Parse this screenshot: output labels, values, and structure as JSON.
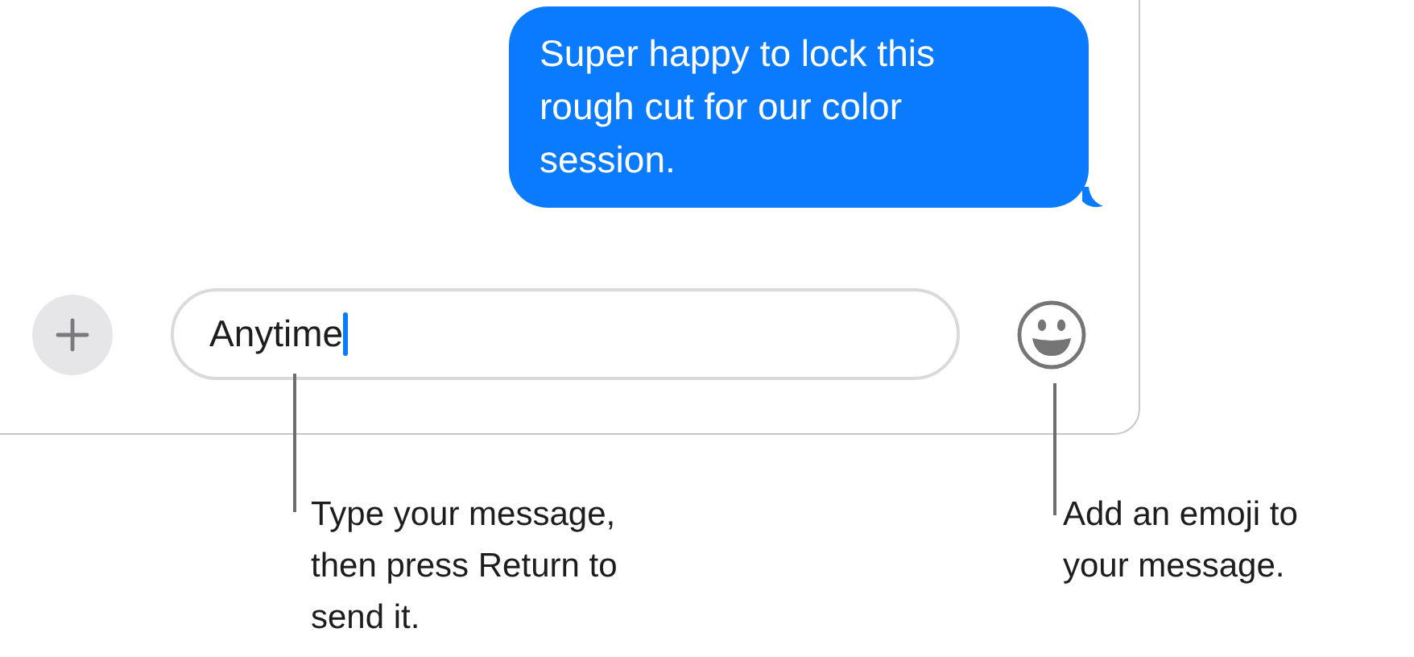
{
  "message": {
    "text": "Super happy to lock this rough cut for our color session."
  },
  "composer": {
    "value": "Anytime"
  },
  "callouts": [
    {
      "text": "Type your message, then press Return to send it."
    },
    {
      "text": "Add an emoji to your message."
    }
  ]
}
